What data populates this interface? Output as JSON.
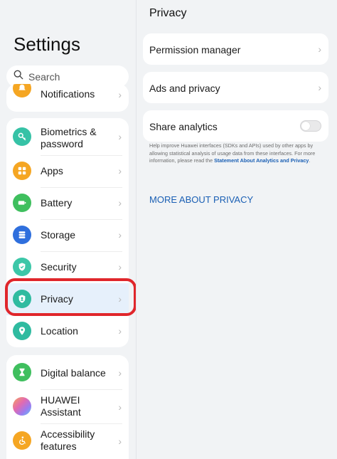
{
  "left": {
    "title": "Settings",
    "search_placeholder": "Search",
    "partial_item": {
      "label": "Notifications",
      "icon": "bell-icon",
      "color": "#f5a623"
    },
    "group1": [
      {
        "label": "Biometrics &\npassword",
        "icon": "key-icon",
        "color": "#36c2a6"
      },
      {
        "label": "Apps",
        "icon": "apps-grid-icon",
        "color": "#f5a623"
      },
      {
        "label": "Battery",
        "icon": "battery-icon",
        "color": "#3fbf5e"
      },
      {
        "label": "Storage",
        "icon": "storage-icon",
        "color": "#2f6fdd"
      },
      {
        "label": "Security",
        "icon": "shield-icon",
        "color": "#3cc7a8"
      },
      {
        "label": "Privacy",
        "icon": "privacy-shield-icon",
        "color": "#2fbba0"
      },
      {
        "label": "Location",
        "icon": "location-pin-icon",
        "color": "#2fbba0"
      }
    ],
    "group2": [
      {
        "label": "Digital balance",
        "icon": "hourglass-icon",
        "color": "#3fbf5e"
      },
      {
        "label": "HUAWEI\nAssistant",
        "icon": "assistant-orb-icon",
        "color": "#c58cf0"
      },
      {
        "label": "Accessibility\nfeatures",
        "icon": "accessibility-icon",
        "color": "#f5a623"
      }
    ]
  },
  "right": {
    "title": "Privacy",
    "items": {
      "permission_manager": "Permission manager",
      "ads_and_privacy": "Ads and privacy",
      "share_analytics": "Share analytics"
    },
    "share_analytics_on": false,
    "help_text": "Help improve Huawei interfaces (SDKs and APIs) used by other apps by allowing statistical analysis of usage data from these interfaces. For more information, please read the ",
    "help_link": "Statement About Analytics and Privacy",
    "help_end": ".",
    "more_about": "MORE ABOUT PRIVACY"
  },
  "colors": {
    "accent_link": "#1a5fb4",
    "selected_row": "#e6f0fb",
    "highlight_ring": "#e0262b"
  }
}
